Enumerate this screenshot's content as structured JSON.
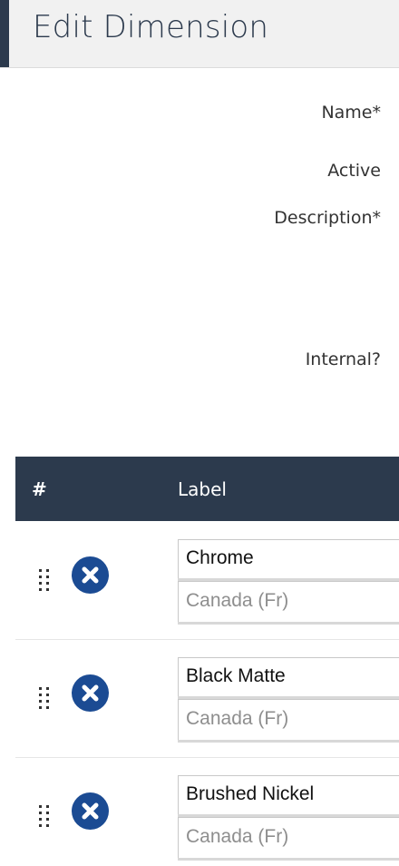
{
  "header": {
    "title": "Edit Dimension"
  },
  "form": {
    "name_label": "Name*",
    "active_label": "Active",
    "description_label": "Description*",
    "internal_label": "Internal?"
  },
  "table": {
    "col_num": "#",
    "col_label": "Label",
    "rows": [
      {
        "label": "Chrome",
        "translation_placeholder": "Canada (Fr)"
      },
      {
        "label": "Black Matte",
        "translation_placeholder": "Canada (Fr)"
      },
      {
        "label": "Brushed Nickel",
        "translation_placeholder": "Canada (Fr)"
      }
    ]
  },
  "colors": {
    "header_bg": "#f1f1f1",
    "accent": "#2c3a4d",
    "remove_button": "#1b4b93"
  },
  "icons": {
    "drag": "drag-handle-icon",
    "remove": "remove-circle-x-icon"
  }
}
